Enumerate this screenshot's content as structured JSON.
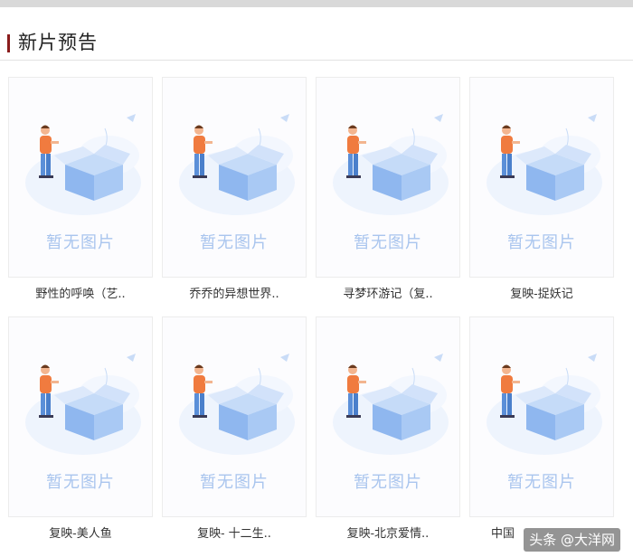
{
  "section": {
    "title": "新片预告"
  },
  "placeholder_text": "暂无图片",
  "movies": [
    {
      "title": "野性的呼唤（艺.."
    },
    {
      "title": "乔乔的异想世界.."
    },
    {
      "title": "寻梦环游记（复.."
    },
    {
      "title": "复映-捉妖记"
    },
    {
      "title": "复映-美人鱼"
    },
    {
      "title": "复映- 十二生.."
    },
    {
      "title": "复映-北京爱情.."
    },
    {
      "title": "中国"
    }
  ],
  "watermark": "头条 @大洋网",
  "colors": {
    "accent": "#8a1c1c",
    "placeholder_text": "#a9c5ee",
    "box_blue": "#8fb7ef",
    "shirt_orange": "#f07b3f"
  }
}
